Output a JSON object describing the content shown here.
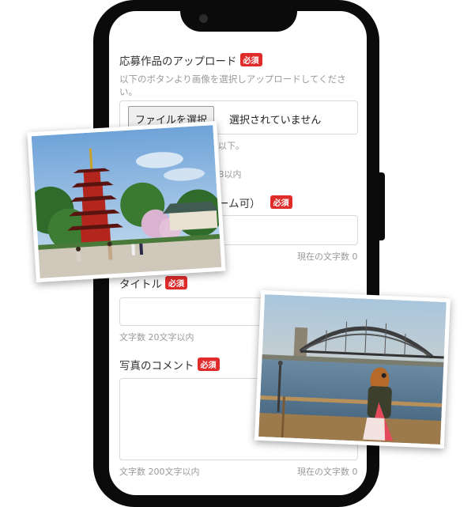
{
  "form": {
    "upload": {
      "label": "応募作品のアップロード",
      "badge": "必須",
      "instruction_line1": "以下のボタンより画像を選択しアップロードしてくださ",
      "instruction_line2": "い。",
      "file_button": "ファイルを選択",
      "file_status": "選択されていません",
      "note1": "以下。",
      "note2": "B以内"
    },
    "name": {
      "label_fragment": "ーム可）",
      "badge": "必須",
      "char_count": "現在の文字数 0"
    },
    "title": {
      "label": "タイトル",
      "badge": "必須",
      "limit": "文字数 20文字以内"
    },
    "comment": {
      "label": "写真のコメント",
      "badge": "必須",
      "limit": "文字数 200文字以内",
      "char_count": "現在の文字数 0"
    }
  },
  "photos": [
    {
      "subject": "red five-story pagoda with trees and visitors"
    },
    {
      "subject": "woman photographing a steel arch bridge over a harbor"
    }
  ],
  "colors": {
    "badge": "#e02b2b",
    "phone": "#0b0b0b"
  }
}
